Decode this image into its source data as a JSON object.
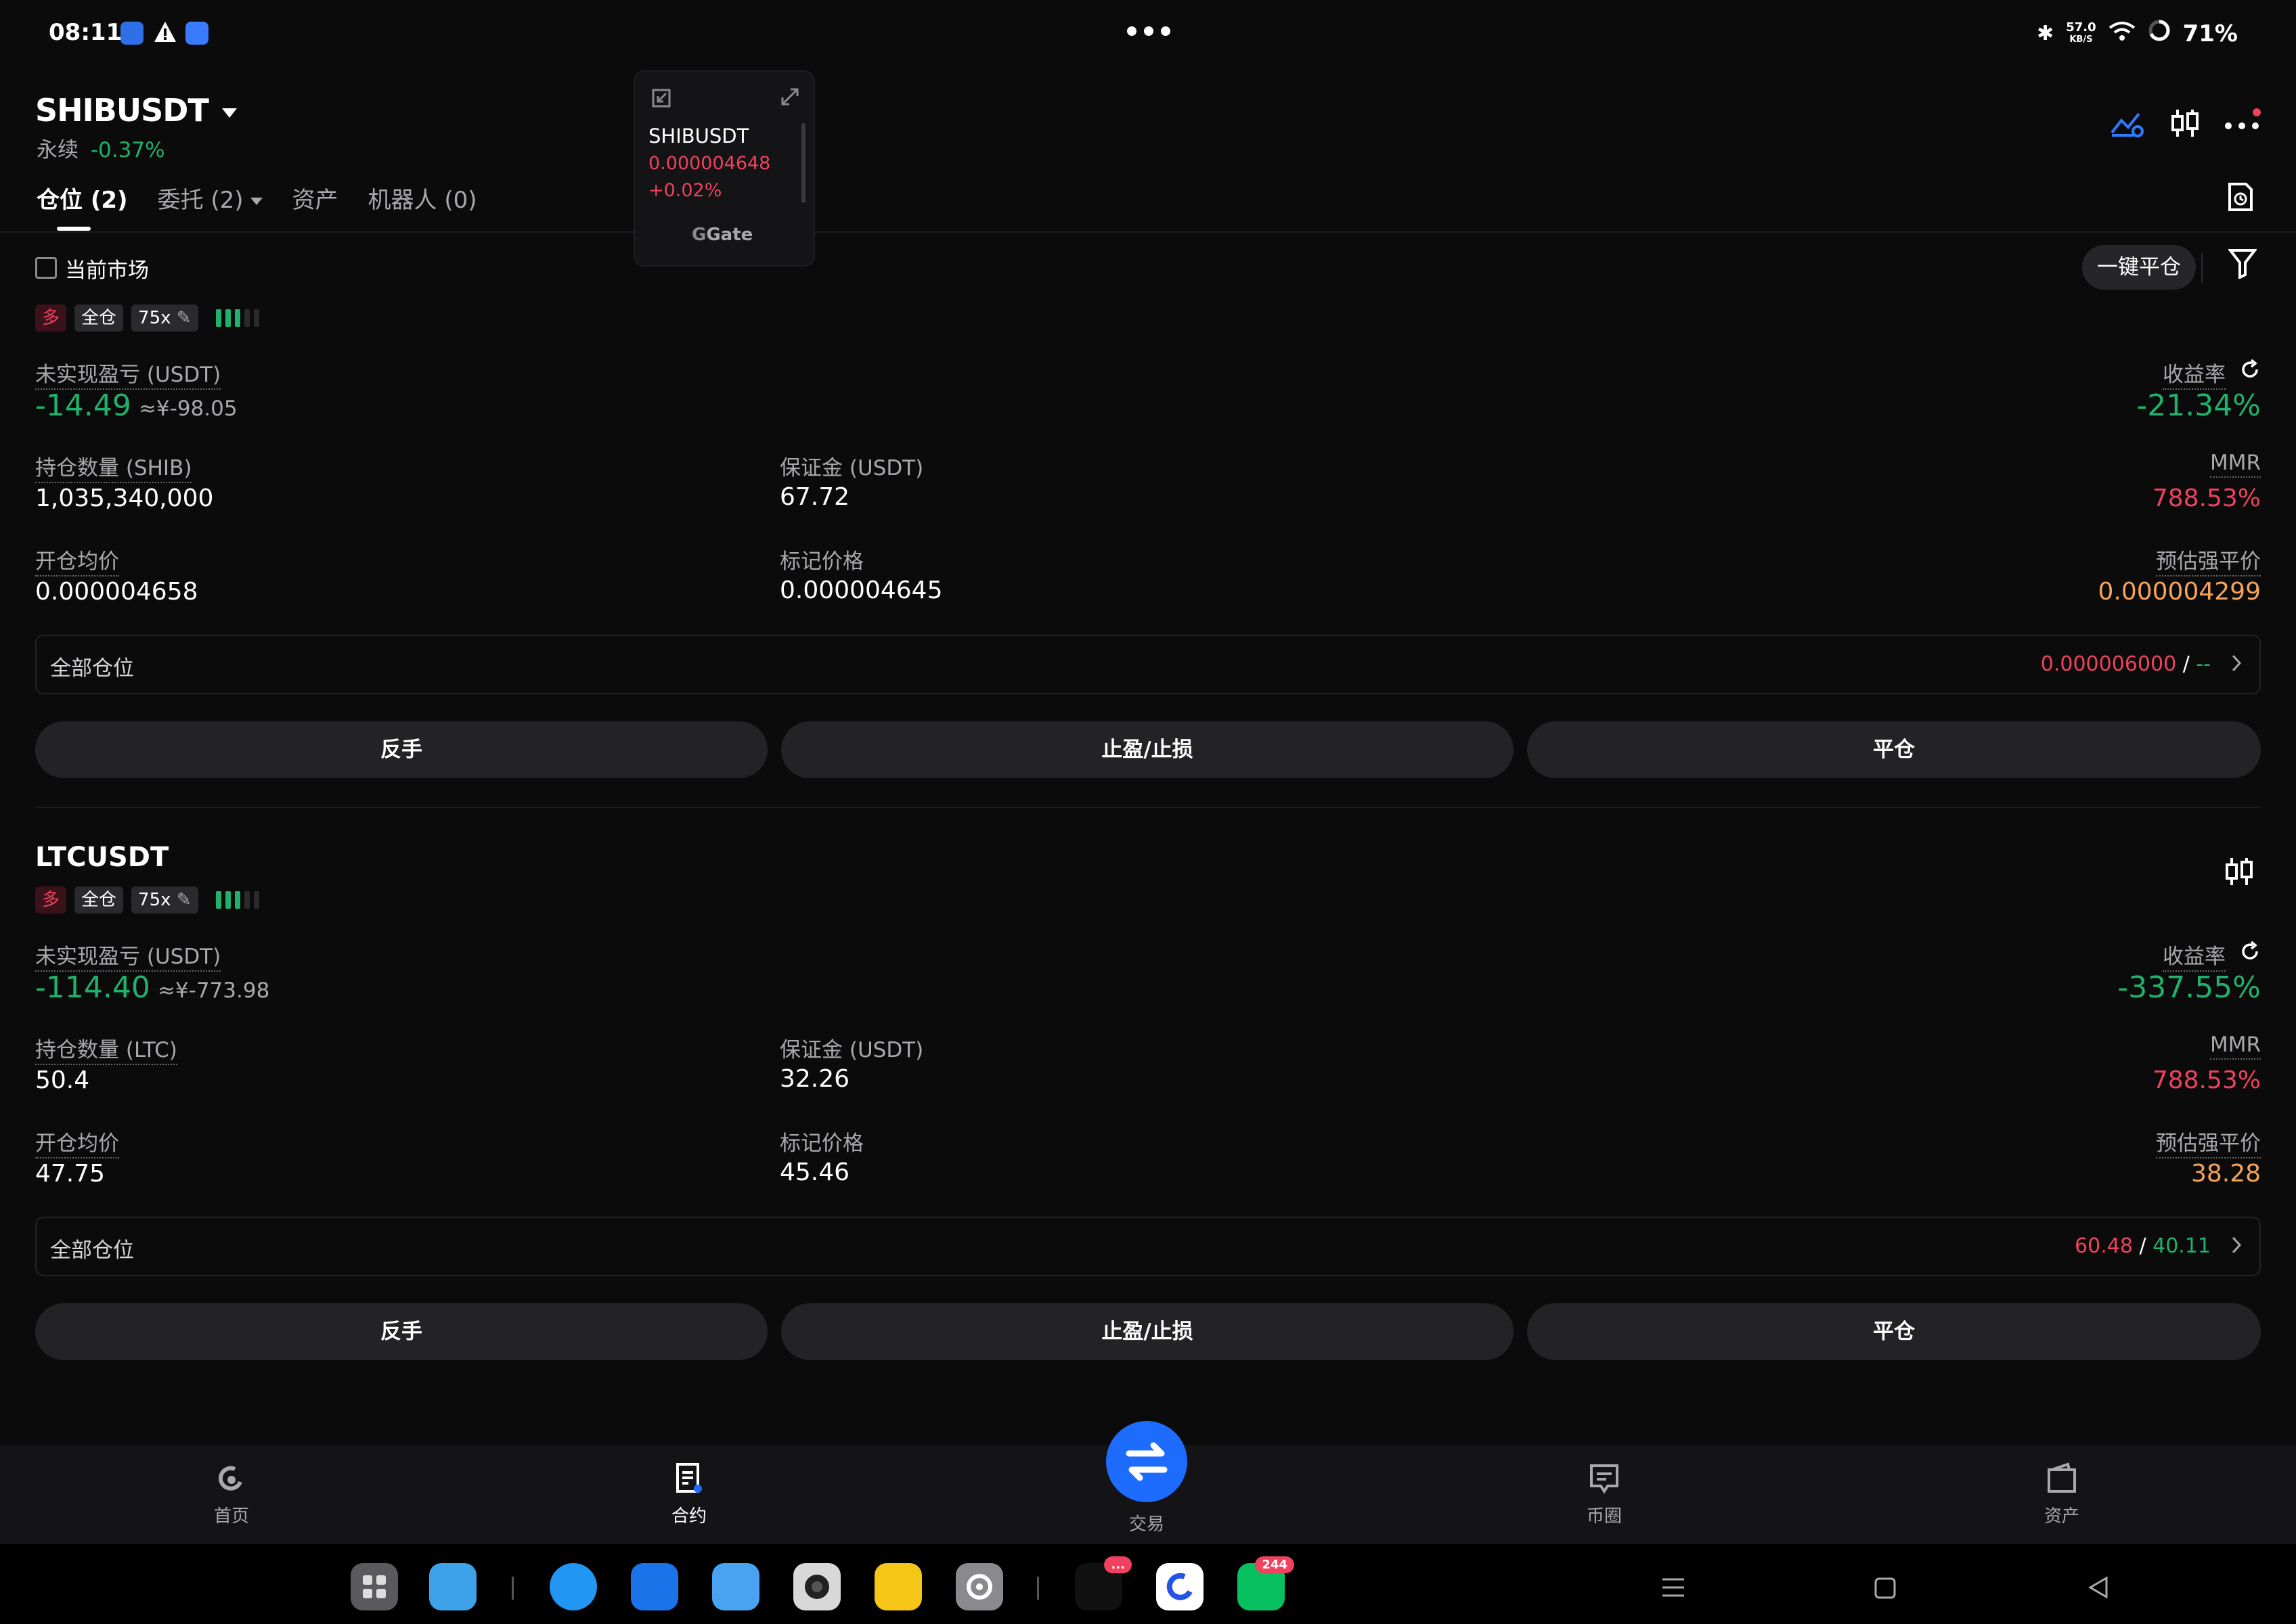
{
  "status_bar": {
    "time": "08:11",
    "speed": "57.0",
    "speed_unit": "KB/S",
    "battery": "71%"
  },
  "header": {
    "symbol": "SHIBUSDT",
    "contract_type": "永续",
    "change": "-0.37%",
    "tabs": [
      {
        "label": "仓位 (2)",
        "active": true
      },
      {
        "label": "委托 (2)"
      },
      {
        "label": "资产"
      },
      {
        "label": "机器人 (0)"
      }
    ]
  },
  "floating_widget": {
    "symbol": "SHIBUSDT",
    "price": "0.000004648",
    "change": "+0.02%",
    "brand": "Gate"
  },
  "filter": {
    "current_market_label": "当前市场",
    "close_all_label": "一键平仓"
  },
  "positions": [
    {
      "symbol": "",
      "side_tag": "多",
      "margin_mode": "全仓",
      "leverage": "75x",
      "pnl_label": "未实现盈亏 (USDT)",
      "pnl": "-14.49",
      "pnl_cny": "≈¥-98.05",
      "roe_label": "收益率",
      "roe": "-21.34%",
      "qty_label": "持仓数量 (SHIB)",
      "qty": "1,035,340,000",
      "margin_label": "保证金 (USDT)",
      "margin": "67.72",
      "mmr_label": "MMR",
      "mmr": "788.53%",
      "entry_label": "开仓均价",
      "entry": "0.000004658",
      "mark_label": "标记价格",
      "mark": "0.000004645",
      "liq_label": "预估强平价",
      "liq": "0.000004299",
      "all_position_label": "全部仓位",
      "tp": "0.000006000",
      "sl": "--",
      "buttons": [
        "反手",
        "止盈/止损",
        "平仓"
      ]
    },
    {
      "symbol": "LTCUSDT",
      "side_tag": "多",
      "margin_mode": "全仓",
      "leverage": "75x",
      "pnl_label": "未实现盈亏 (USDT)",
      "pnl": "-114.40",
      "pnl_cny": "≈¥-773.98",
      "roe_label": "收益率",
      "roe": "-337.55%",
      "qty_label": "持仓数量 (LTC)",
      "qty": "50.4",
      "margin_label": "保证金 (USDT)",
      "margin": "32.26",
      "mmr_label": "MMR",
      "mmr": "788.53%",
      "entry_label": "开仓均价",
      "entry": "47.75",
      "mark_label": "标记价格",
      "mark": "45.46",
      "liq_label": "预估强平价",
      "liq": "38.28",
      "all_position_label": "全部仓位",
      "tp": "60.48",
      "sl": "40.11",
      "buttons": [
        "反手",
        "止盈/止损",
        "平仓"
      ]
    }
  ],
  "bottom_nav": {
    "items": [
      "首页",
      "合约",
      "交易",
      "币圈",
      "资产"
    ],
    "active": "合约"
  },
  "dock": {
    "badges": {
      "tiktok": "...",
      "wechat": "244"
    }
  },
  "colors": {
    "background": "#0b0b0b",
    "green": "#20b26c",
    "red": "#f0415e",
    "orange": "#f7a35c",
    "accent_blue": "#1e6cff"
  }
}
